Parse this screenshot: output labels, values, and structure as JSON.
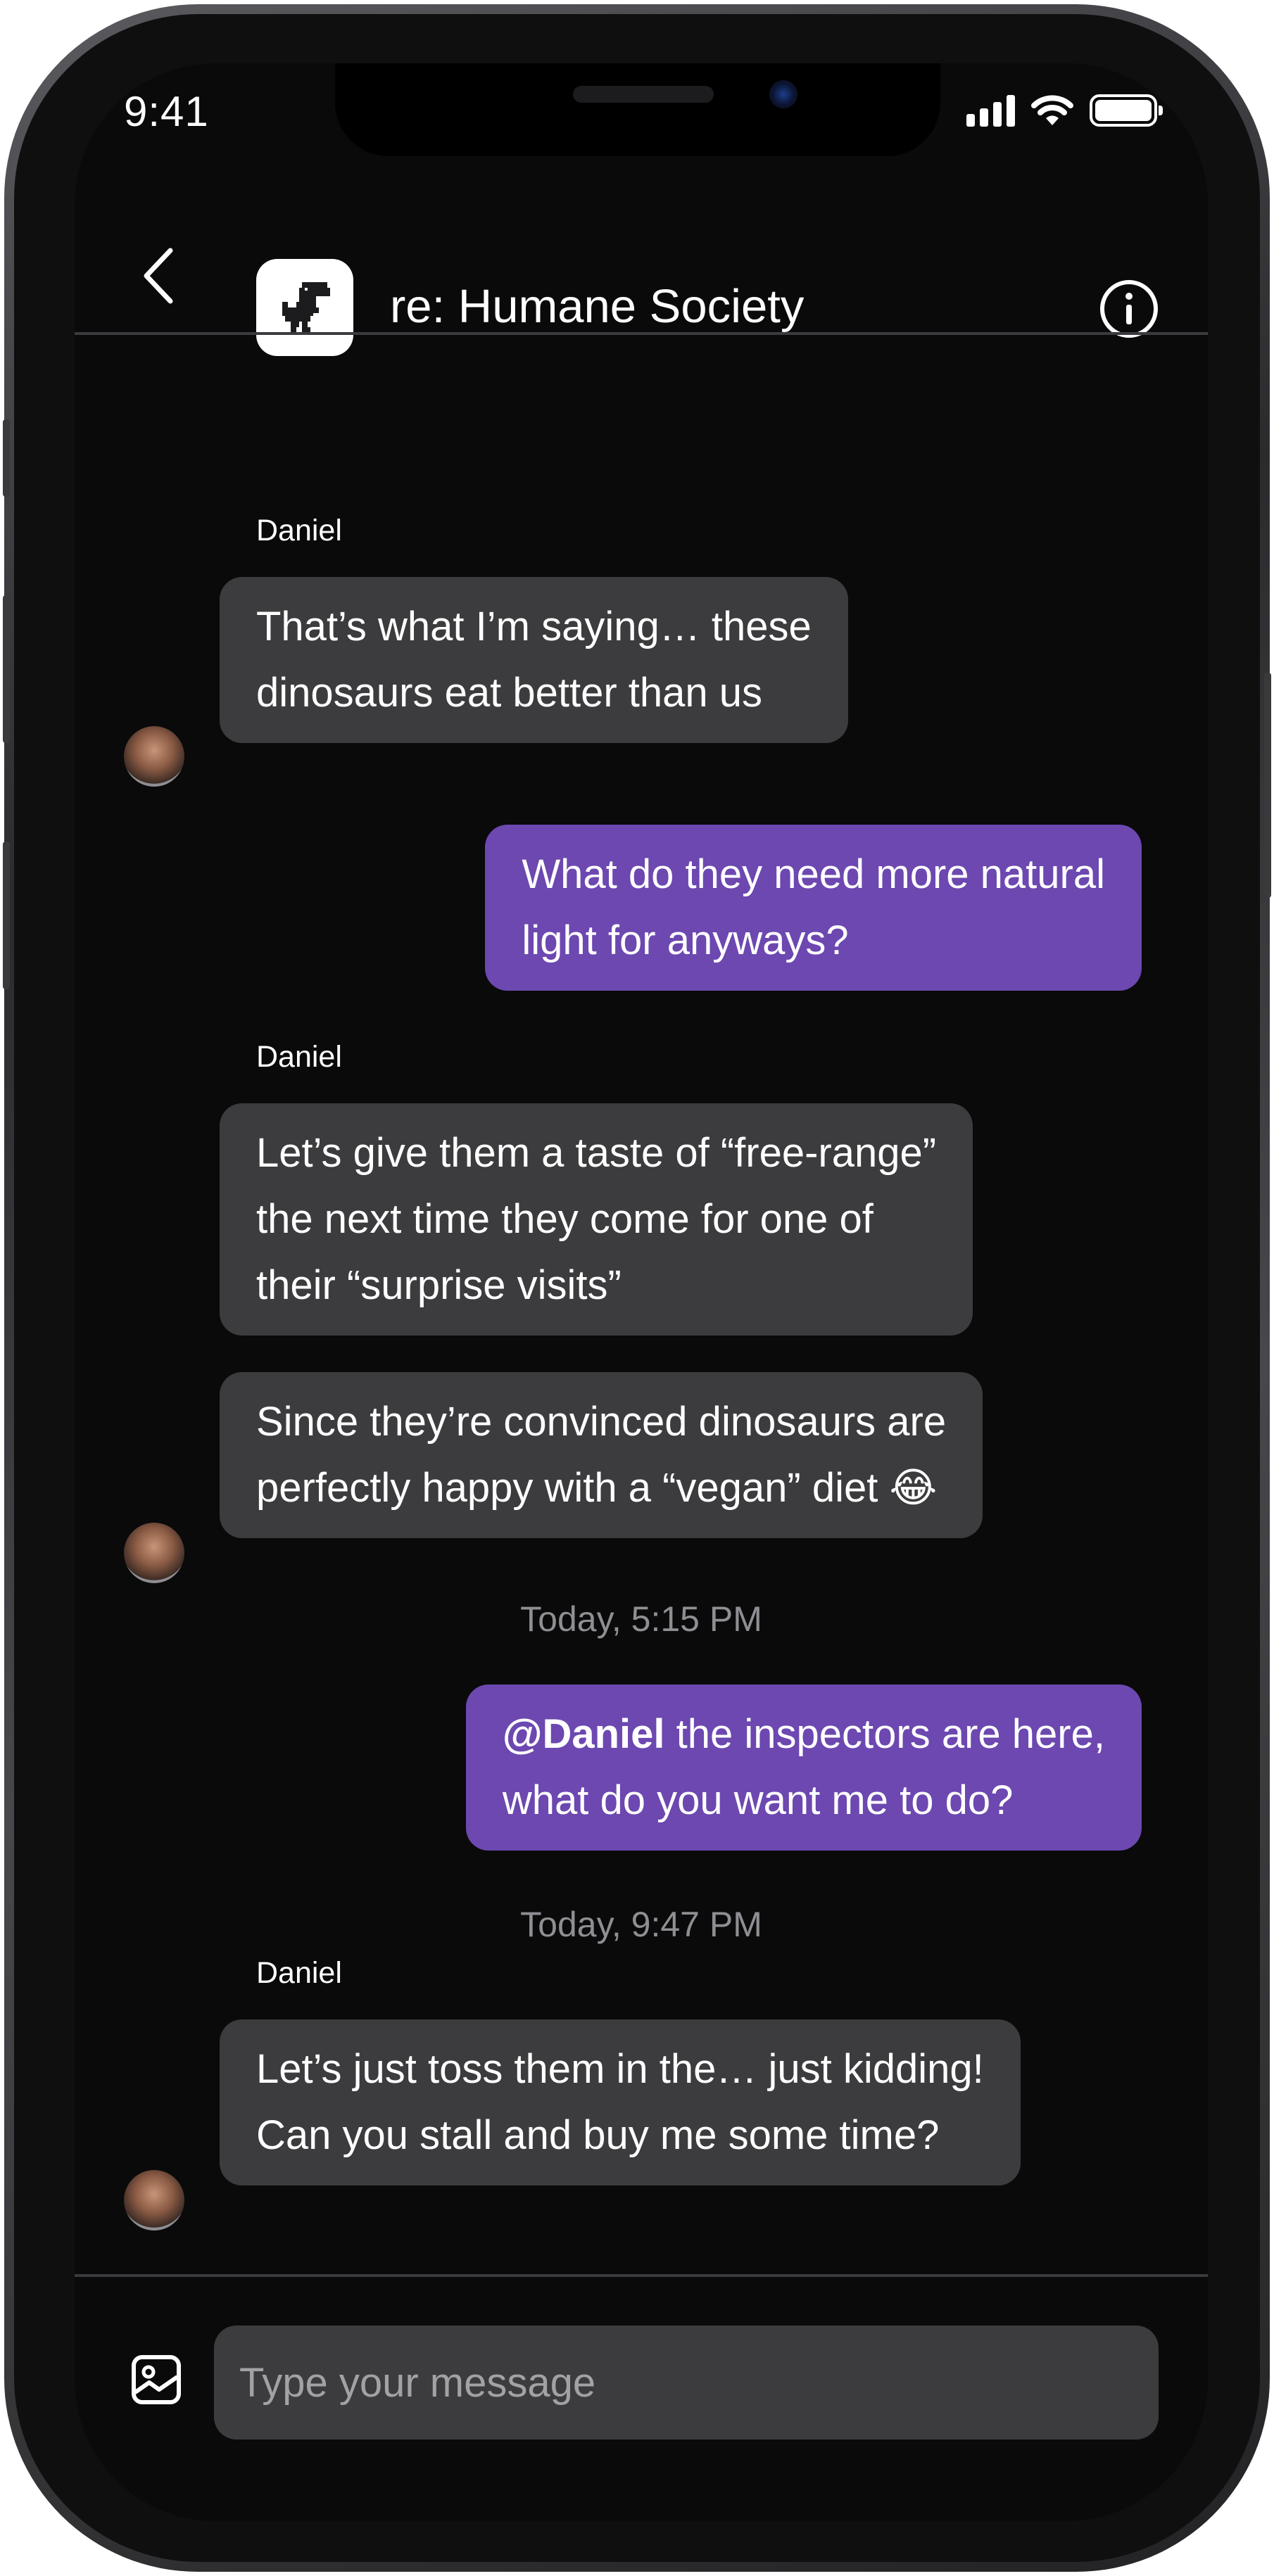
{
  "status_bar": {
    "time": "9:41"
  },
  "header": {
    "title": "re: Humane Society",
    "back_icon": "chevron-left-icon",
    "app_icon": "pixel-dinosaur-icon",
    "info_icon": "info-icon"
  },
  "messages": [
    {
      "sender": "Daniel",
      "bubbles": [
        {
          "direction": "incoming",
          "text": "That’s what I’m saying… these dinosaurs eat better than us",
          "lines": [
            "That’s what I’m saying… these",
            "dinosaurs eat better than us"
          ]
        }
      ]
    },
    {
      "bubbles": [
        {
          "direction": "outgoing",
          "text": "What do they need more natural light for anyways?",
          "lines": [
            "What do they need more natural",
            "light for anyways?"
          ]
        }
      ]
    },
    {
      "sender": "Daniel",
      "bubbles": [
        {
          "direction": "incoming",
          "text": "Let’s give them a taste of “free-range” the next time they come for one of their “surprise visits”",
          "lines": [
            "Let’s give them a taste of “free-range”",
            "the next time they come for one of",
            "their “surprise visits”"
          ]
        },
        {
          "direction": "incoming",
          "text": "Since they’re convinced dinosaurs are perfectly happy with a “vegan” diet 😂",
          "lines": [
            "Since they’re convinced dinosaurs are",
            "perfectly happy with a “vegan” diet 😂"
          ]
        }
      ]
    },
    {
      "timestamp": "Today, 5:15 PM"
    },
    {
      "bubbles": [
        {
          "direction": "outgoing",
          "mention": "@Daniel",
          "text": " the inspectors are here, what do you want me to do?",
          "lines": [
            " the inspectors are here,",
            "what do you want me to do?"
          ]
        }
      ]
    },
    {
      "timestamp": "Today, 9:47 PM"
    },
    {
      "sender": "Daniel",
      "bubbles": [
        {
          "direction": "incoming",
          "text": "Let’s just toss them in the… just kidding! Can you stall and buy me some time?",
          "lines": [
            "Let’s just toss them in the… just kidding!",
            "Can you stall and buy me some time?"
          ]
        }
      ]
    }
  ],
  "composer": {
    "placeholder": "Type your message",
    "attach_icon": "image-icon"
  },
  "colors": {
    "background": "#0a0a0b",
    "incoming_bubble": "#3c3c3e",
    "outgoing_bubble": "#6c48b0",
    "timestamp": "#8e8e93"
  }
}
